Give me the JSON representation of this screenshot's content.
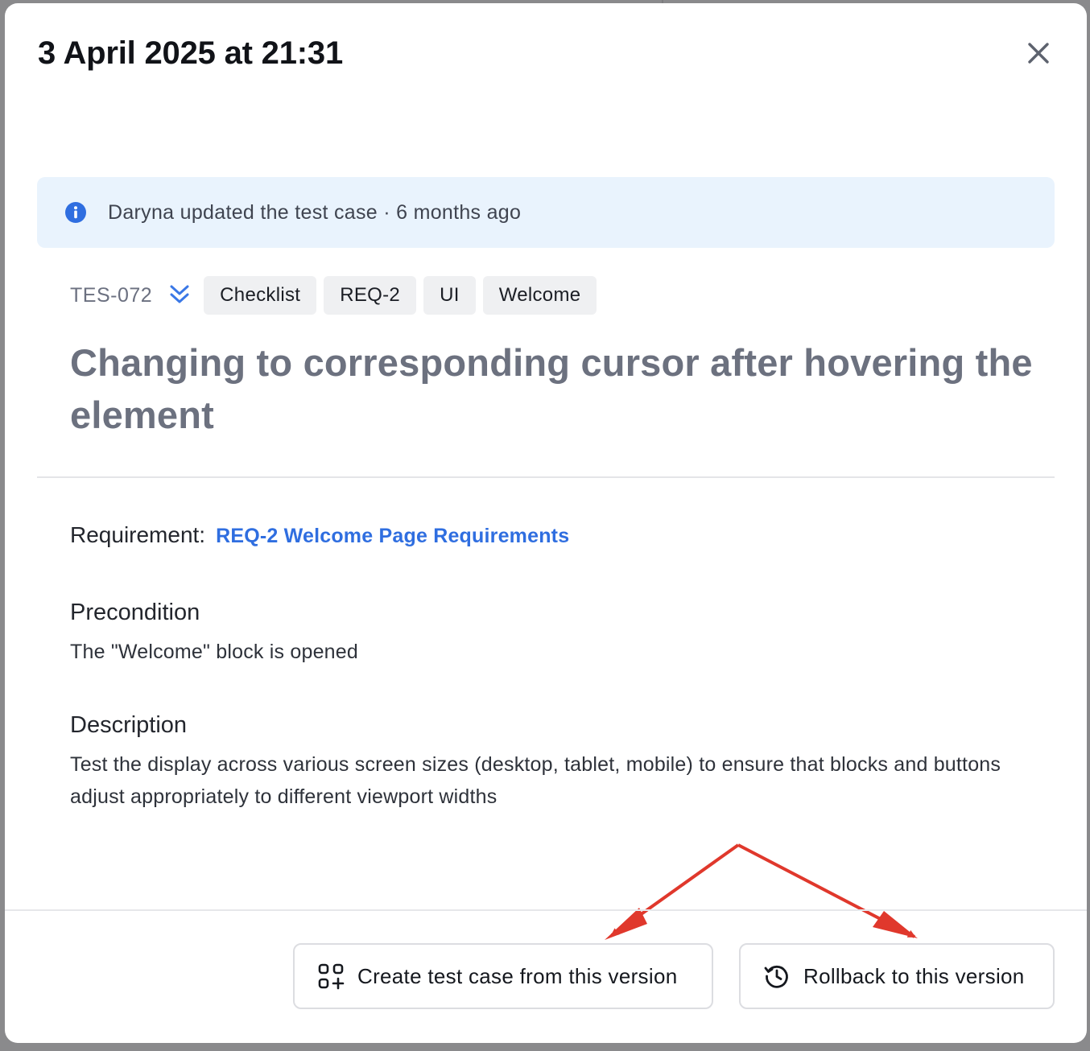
{
  "modal": {
    "title": "3 April 2025 at 21:31"
  },
  "banner": {
    "text": "Daryna updated the test case · 6 months ago",
    "accent": "#2f6ee0",
    "background": "#e9f3fd"
  },
  "test_case": {
    "id": "TES-072",
    "tags": [
      "Checklist",
      "REQ-2",
      "UI",
      "Welcome"
    ],
    "title": "Changing to corresponding cursor after hovering the element",
    "requirement_label": "Requirement:",
    "requirement_link": "REQ-2 Welcome Page Requirements",
    "precondition_heading": "Precondition",
    "precondition_text": "The \"Welcome\" block is opened",
    "description_heading": "Description",
    "description_text": "Test the display across various screen sizes (desktop, tablet, mobile) to ensure that blocks and buttons adjust appropriately to different viewport widths"
  },
  "footer": {
    "create_label": "Create test case from this version",
    "rollback_label": "Rollback to this version"
  },
  "annotation": {
    "arrow_color": "#e0382c"
  },
  "icons": {
    "close": "close-icon",
    "info": "info-icon",
    "priority": "double-chevron-down-icon",
    "create": "create-from-version-icon",
    "rollback": "history-icon"
  }
}
